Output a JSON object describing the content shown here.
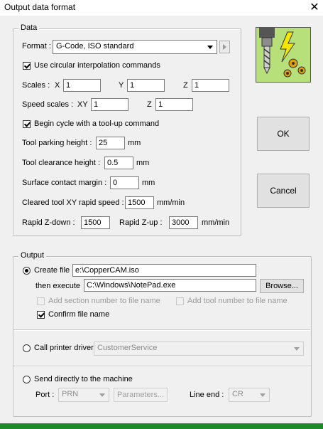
{
  "window": {
    "title": "Output data format",
    "close": "✕"
  },
  "data_group": {
    "legend": "Data",
    "format_label": "Format :",
    "format_value": "G-Code, ISO standard",
    "circular_label": "Use circular interpolation commands",
    "circular_checked": true,
    "scales_label": "Scales :",
    "x_label": "X",
    "x_value": "1",
    "y_label": "Y",
    "y_value": "1",
    "z_label": "Z",
    "z_value": "1",
    "speed_label": "Speed scales :",
    "xy_label": "XY",
    "xy_value": "1",
    "speed_z_label": "Z",
    "speed_z_value": "1",
    "toolup_label": "Begin cycle with a tool-up command",
    "toolup_checked": true,
    "parking_label": "Tool parking height :",
    "parking_value": "25",
    "parking_unit": "mm",
    "clearance_label": "Tool clearance height :",
    "clearance_value": "0.5",
    "clearance_unit": "mm",
    "surface_label": "Surface contact margin :",
    "surface_value": "0",
    "surface_unit": "mm",
    "rapid_label": "Cleared tool XY rapid speed :",
    "rapid_value": "1500",
    "rapid_unit": "mm/min",
    "zdown_label": "Rapid Z-down :",
    "zdown_value": "1500",
    "zup_label": "Rapid Z-up :",
    "zup_value": "3000",
    "zup_unit": "mm/min"
  },
  "buttons": {
    "ok": "OK",
    "cancel": "Cancel"
  },
  "output_group": {
    "legend": "Output",
    "create_label": "Create file",
    "create_value": "e:\\CopperCAM.iso",
    "then_label": "then execute",
    "then_value": "C:\\Windows\\NotePad.exe",
    "browse": "Browse...",
    "add_section": "Add section number to file name",
    "add_tool": "Add tool number to file name",
    "confirm": "Confirm file name",
    "confirm_checked": true,
    "printer_label": "Call printer driver",
    "printer_value": "CustomerService",
    "send_label": "Send directly to the machine",
    "port_label": "Port :",
    "port_value": "PRN",
    "parameters": "Parameters...",
    "line_end_label": "Line end :",
    "line_end_value": "CR"
  },
  "colors": {
    "accent_green": "#1f8a2a",
    "logo_bg": "#b7e07a"
  }
}
